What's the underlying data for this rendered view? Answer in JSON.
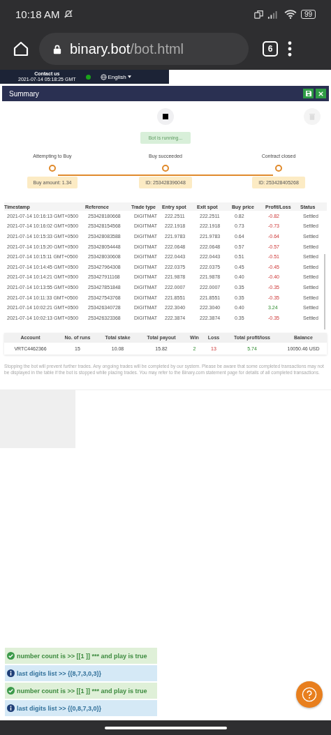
{
  "status_bar": {
    "time": "10:18 AM",
    "battery": "99"
  },
  "browser": {
    "url_host": "binary.bot",
    "url_path": "/bot.html",
    "tab_count": "6"
  },
  "header": {
    "contact": "Contact us",
    "datetime": "2021-07-14 05:18:25 GMT",
    "connected": true,
    "language": "English"
  },
  "summary": {
    "title": "Summary",
    "status_text": "Bot is running...",
    "steps": [
      {
        "label": "Attempting to Buy",
        "detail": "Buy amount: 1.34"
      },
      {
        "label": "Buy succeeded",
        "detail": "ID: 253428396048"
      },
      {
        "label": "Contract closed",
        "detail": "ID: 253428405268"
      }
    ],
    "table": {
      "columns": [
        "Timestamp",
        "Reference",
        "Trade type",
        "Entry spot",
        "Exit spot",
        "Buy price",
        "Profit/Loss",
        "Status"
      ],
      "rows": [
        {
          "cells": [
            "2021-07-14 10:16:13 GMT+0500",
            "253428180668",
            "DIGITMAT",
            "222.2511",
            "222.2511",
            "0.82",
            "-0.82",
            "Settled"
          ],
          "win": false
        },
        {
          "cells": [
            "2021-07-14 10:16:02 GMT+0500",
            "253428154568",
            "DIGITMAT",
            "222.1918",
            "222.1918",
            "0.73",
            "-0.73",
            "Settled"
          ],
          "win": false
        },
        {
          "cells": [
            "2021-07-14 10:15:33 GMT+0500",
            "253428083588",
            "DIGITMAT",
            "221.9783",
            "221.9783",
            "0.64",
            "-0.64",
            "Settled"
          ],
          "win": false
        },
        {
          "cells": [
            "2021-07-14 10:15:20 GMT+0500",
            "253428054448",
            "DIGITMAT",
            "222.0648",
            "222.0648",
            "0.57",
            "-0.57",
            "Settled"
          ],
          "win": false
        },
        {
          "cells": [
            "2021-07-14 10:15:11 GMT+0500",
            "253428030608",
            "DIGITMAT",
            "222.0443",
            "222.0443",
            "0.51",
            "-0.51",
            "Settled"
          ],
          "win": false
        },
        {
          "cells": [
            "2021-07-14 10:14:45 GMT+0500",
            "253427964308",
            "DIGITMAT",
            "222.0375",
            "222.0375",
            "0.45",
            "-0.45",
            "Settled"
          ],
          "win": false
        },
        {
          "cells": [
            "2021-07-14 10:14:21 GMT+0500",
            "253427911168",
            "DIGITMAT",
            "221.9878",
            "221.9878",
            "0.40",
            "-0.40",
            "Settled"
          ],
          "win": false
        },
        {
          "cells": [
            "2021-07-14 10:13:55 GMT+0500",
            "253427851848",
            "DIGITMAT",
            "222.0007",
            "222.0007",
            "0.35",
            "-0.35",
            "Settled"
          ],
          "win": false
        },
        {
          "cells": [
            "2021-07-14 10:11:33 GMT+0500",
            "253427543768",
            "DIGITMAT",
            "221.8551",
            "221.8551",
            "0.35",
            "-0.35",
            "Settled"
          ],
          "win": false
        },
        {
          "cells": [
            "2021-07-14 10:02:21 GMT+0500",
            "253426340728",
            "DIGITMAT",
            "222.3040",
            "222.3040",
            "0.40",
            "3.24",
            "Settled"
          ],
          "win": true
        },
        {
          "cells": [
            "2021-07-14 10:02:13 GMT+0500",
            "253426323368",
            "DIGITMAT",
            "222.3874",
            "222.3874",
            "0.35",
            "-0.35",
            "Settled"
          ],
          "win": false
        }
      ]
    },
    "totals": {
      "columns": [
        "Account",
        "No. of runs",
        "Total stake",
        "Total payout",
        "Win",
        "Loss",
        "Total profit/loss",
        "Balance"
      ],
      "values": [
        {
          "text": "VRTC4462366",
          "kind": "plain"
        },
        {
          "text": "15",
          "kind": "plain"
        },
        {
          "text": "10.08",
          "kind": "plain"
        },
        {
          "text": "15.82",
          "kind": "plain"
        },
        {
          "text": "2",
          "kind": "gain"
        },
        {
          "text": "13",
          "kind": "loss"
        },
        {
          "text": "5.74",
          "kind": "gain"
        },
        {
          "text": "10050.46 USD",
          "kind": "plain"
        }
      ]
    },
    "disclaimer": "Stopping the bot will prevent further trades. Any ongoing trades will be completed by our system. Please be aware that some completed transactions may not be displayed in the table if the bot is stopped while placing trades. You may refer to the Binary.com statement page for details of all completed transactions."
  },
  "notifications": [
    {
      "kind": "success",
      "text": "number count is >> [[1 ]] *** and play is true"
    },
    {
      "kind": "info",
      "text": "last digits list >> {(8,7,3,0,3)}"
    },
    {
      "kind": "success",
      "text": "number count is >> [[1 ]] *** and play is true"
    },
    {
      "kind": "info",
      "text": "last digits list >> {(0,8,7,3,0)}"
    }
  ]
}
